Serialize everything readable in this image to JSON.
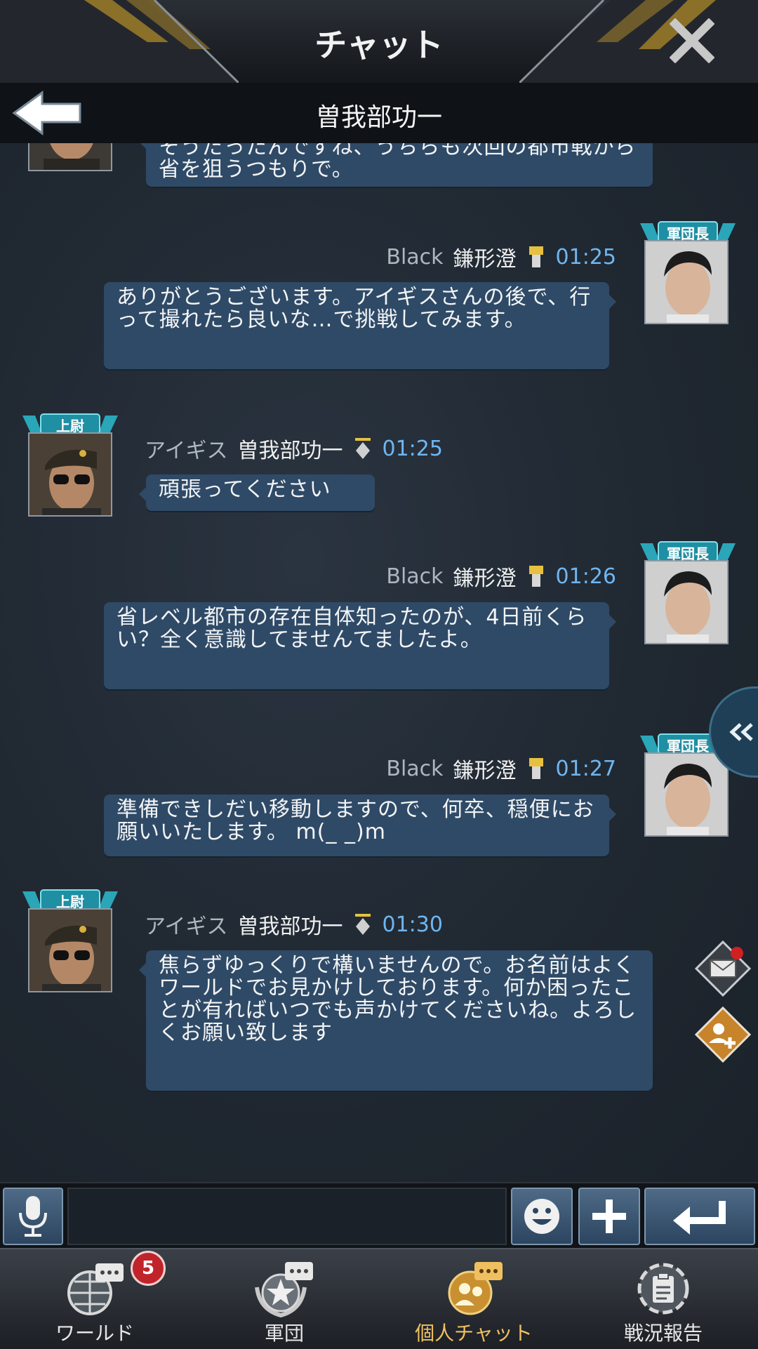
{
  "header": {
    "title": "チャット"
  },
  "subheader": {
    "title": "曽我部功一"
  },
  "messages": [
    {
      "text": "そうだったんですね、うちらも次回の都市戦から省を狙うつもりで。"
    },
    {
      "rank": "軍団長",
      "alliance": "Black",
      "name": "鎌形澄",
      "time": "01:25",
      "text": "ありがとうございます。アイギスさんの後で、行って撮れたら良いな…で挑戦してみます。"
    },
    {
      "rank": "上尉",
      "alliance": "アイギス",
      "name": "曽我部功一",
      "time": "01:25",
      "text": "頑張ってください"
    },
    {
      "rank": "軍団長",
      "alliance": "Black",
      "name": "鎌形澄",
      "time": "01:26",
      "text": "省レベル都市の存在自体知ったのが、4日前くらい？全く意識してませんてましたよ。"
    },
    {
      "rank": "軍団長",
      "alliance": "Black",
      "name": "鎌形澄",
      "time": "01:27",
      "text": "準備できしだい移動しますので、何卒、穏便にお願いいたします。 m(_ _)m"
    },
    {
      "rank": "上尉",
      "alliance": "アイギス",
      "name": "曽我部功一",
      "time": "01:30",
      "text": "焦らずゆっくりで構いませんので。お名前はよくワールドでお見かけしております。何か困ったことが有ればいつでも声かけてくださいね。よろしくお願い致します"
    }
  ],
  "input": {
    "value": ""
  },
  "nav": [
    {
      "label": "ワールド",
      "badge": "5",
      "icon": "world-chat-icon"
    },
    {
      "label": "軍団",
      "icon": "legion-chat-icon"
    },
    {
      "label": "個人チャット",
      "icon": "private-chat-icon",
      "active": true
    },
    {
      "label": "戦況報告",
      "icon": "battle-report-icon"
    }
  ],
  "colors": {
    "background": "#1f2730",
    "bubble": "#2f4a66",
    "time": "#6fb6f0",
    "active_nav": "#f0c060",
    "badge": "#c0242a"
  }
}
